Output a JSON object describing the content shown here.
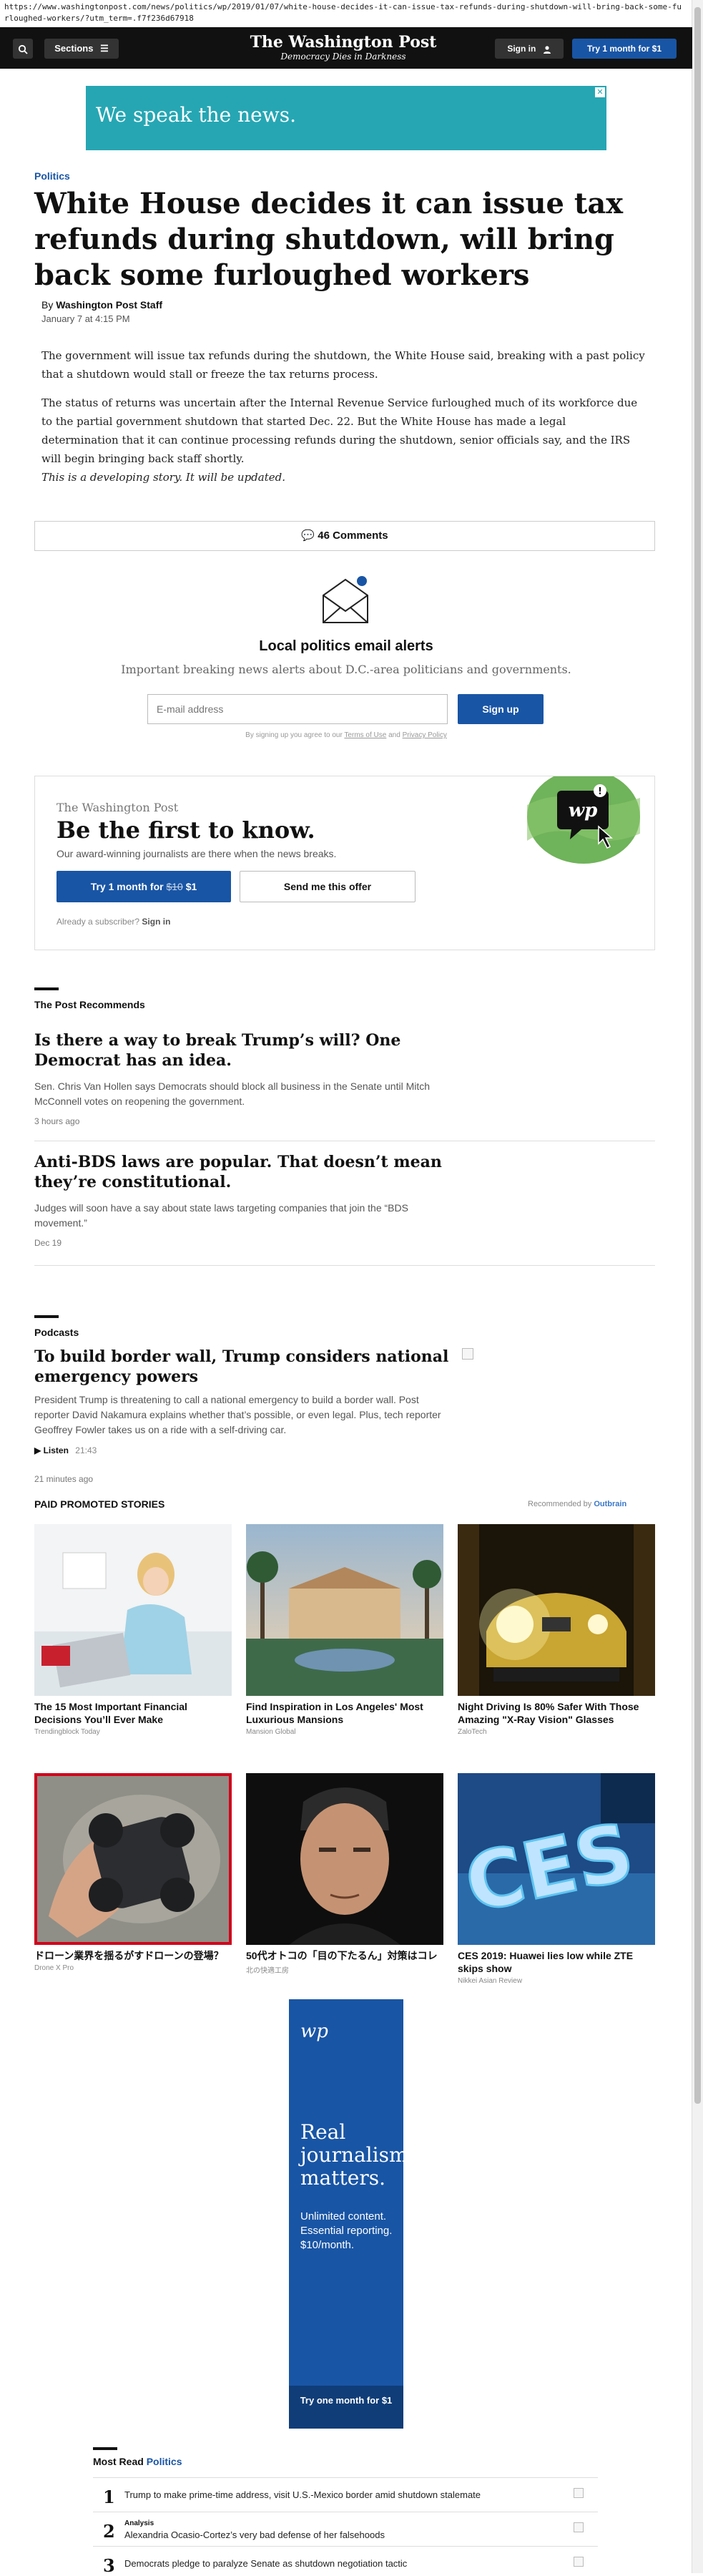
{
  "browser": {
    "url": "https://www.washingtonpost.com/news/politics/wp/2019/01/07/white-house-decides-it-can-issue-tax-refunds-during-shutdown-will-bring-back-some-furloughed-workers/?utm_term=.f7f236d67918"
  },
  "header": {
    "sections_label": "Sections",
    "logo": "The Washington Post",
    "tagline": "Democracy Dies in Darkness",
    "signin_label": "Sign in",
    "trial_label": "Try 1 month for $1"
  },
  "top_ad": {
    "text": "We speak the news."
  },
  "article": {
    "kicker": "Politics",
    "headline": "White House decides it can issue tax refunds during shutdown, will bring back some furloughed workers",
    "by": "By",
    "author": "Washington Post Staff",
    "date": "January 7 at 4:15 PM",
    "paragraphs": [
      "The government will issue tax refunds during the shutdown, the White House said, breaking with a past policy that a shutdown would stall or freeze the tax returns process.",
      "The status of returns was uncertain after the Internal Revenue Service furloughed much of its workforce due to the partial government shutdown that started Dec. 22. But the White House has made a legal determination that it can continue processing refunds during the shutdown, senior officials say, and the IRS will begin bringing back staff shortly."
    ],
    "update_note": "This is a developing story. It will be updated.",
    "comments_label": "46 Comments"
  },
  "newsletter": {
    "title": "Local politics email alerts",
    "description": "Important breaking news alerts about D.C.-area politicians and governments.",
    "email_placeholder": "E-mail address",
    "signup_label": "Sign up",
    "terms_prefix": "By signing up you agree to our",
    "terms_link": "Terms of Use",
    "and": "and",
    "privacy_link": "Privacy Policy"
  },
  "offer": {
    "brand": "The Washington Post",
    "headline": "Be the first to know.",
    "sub": "Our award-winning journalists are there when the news breaks.",
    "try_prefix": "Try 1 month for",
    "try_old_price": "$10",
    "try_price": "$1",
    "send_label": "Send me this offer",
    "already_prefix": "Already a subscriber?",
    "already_signin": "Sign in",
    "badge_text": "wp"
  },
  "recommends": {
    "section": "The Post Recommends",
    "items": [
      {
        "title": "Is there a way to break Trump’s will? One Democrat has an idea.",
        "desc": "Sen. Chris Van Hollen says Democrats should block all business in the Senate until Mitch McConnell votes on reopening the government.",
        "time": "3 hours ago"
      },
      {
        "title": "Anti-BDS laws are popular. That doesn’t mean they’re constitutional.",
        "desc": "Judges will soon have a say about state laws targeting companies that join the “BDS movement.”",
        "time": "Dec 19"
      }
    ]
  },
  "podcasts": {
    "section": "Podcasts",
    "title": "To build border wall, Trump considers national emergency powers",
    "desc": "President Trump is threatening to call a national emergency to build a border wall. Post reporter David Nakamura explains whether that’s possible, or even legal. Plus, tech reporter Geoffrey Fowler takes us on a ride with a self-driving car.",
    "listen_label": "Listen",
    "duration": "21:43",
    "time": "21 minutes ago"
  },
  "promoted": {
    "title": "PAID PROMOTED STORIES",
    "recommended_by": "Recommended by",
    "brand": "Outbrain",
    "cards": [
      {
        "title": "The 15 Most Important Financial Decisions You’ll Ever Make",
        "source": "Trendingblock Today"
      },
      {
        "title": "Find Inspiration in Los Angeles' Most Luxurious Mansions",
        "source": "Mansion Global"
      },
      {
        "title": "Night Driving Is 80% Safer With Those Amazing \"X-Ray Vision\" Glasses",
        "source": "ZaloTech"
      },
      {
        "title": "ドローン業界を揺るがすドローンの登場？",
        "source": "Drone X Pro"
      },
      {
        "title": "50代オトコの「目の下たるん」対策はコレ",
        "source": "北の快適工房"
      },
      {
        "title": "CES 2019: Huawei lies low while ZTE skips show",
        "source": "Nikkei Asian Review"
      }
    ],
    "ces_text": "CES"
  },
  "side_ad": {
    "logo": "wp",
    "headline": "Real journalism matters.",
    "sub": "Unlimited content. Essential reporting. $10/month.",
    "cta": "Try one month for $1"
  },
  "most_read": {
    "title": "Most Read",
    "section": "Politics",
    "items": [
      {
        "num": "1",
        "label": "",
        "text": "Trump to make prime-time address, visit U.S.-Mexico border amid shutdown stalemate"
      },
      {
        "num": "2",
        "label": "Analysis",
        "text": "Alexandria Ocasio-Cortez’s very bad defense of her falsehoods"
      },
      {
        "num": "3",
        "label": "",
        "text": "Democrats pledge to paralyze Senate as shutdown negotiation tactic"
      }
    ]
  },
  "colors": {
    "brand_blue": "#1955a5",
    "ad_teal": "#26a6b3",
    "selected_outline": "#d0021b"
  }
}
